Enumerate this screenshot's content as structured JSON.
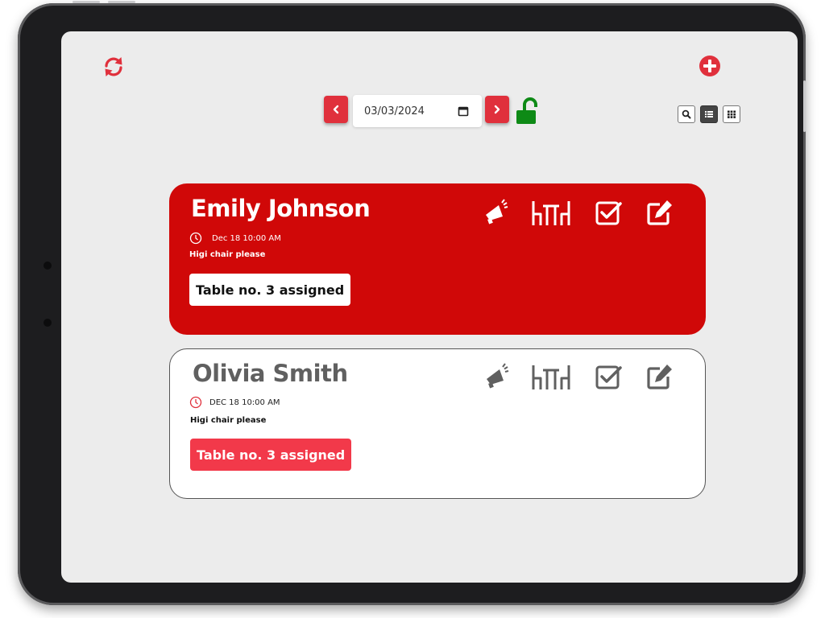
{
  "toolbar": {
    "date_value": "03/03/2024",
    "lock_state": "unlocked",
    "views": [
      "search",
      "list",
      "grid"
    ],
    "active_view": "list"
  },
  "reservations": [
    {
      "name": "Emily Johnson",
      "time": "Dec 18 10:00 AM",
      "note": "Higi chair please",
      "table": "Table no. 3 assigned",
      "highlighted": true
    },
    {
      "name": "Olivia Smith",
      "time": "DEC 18 10:00 AM",
      "note": "Higi chair please",
      "table": "Table no. 3 assigned",
      "highlighted": false
    }
  ],
  "icons": {
    "refresh": "sync-arrows",
    "add": "plus-circle",
    "prev": "chevron-left",
    "next": "chevron-right",
    "calendar": "calendar",
    "lock": "lock-open",
    "card_actions": [
      "megaphone",
      "table-chairs",
      "checkbox",
      "edit"
    ]
  },
  "colors": {
    "accent_red": "#e0303c",
    "card_red": "#d00808",
    "tag_red": "#f2394a",
    "lock_green": "#0e8a16",
    "grey_text": "#606060",
    "screen_bg": "#ececec"
  }
}
